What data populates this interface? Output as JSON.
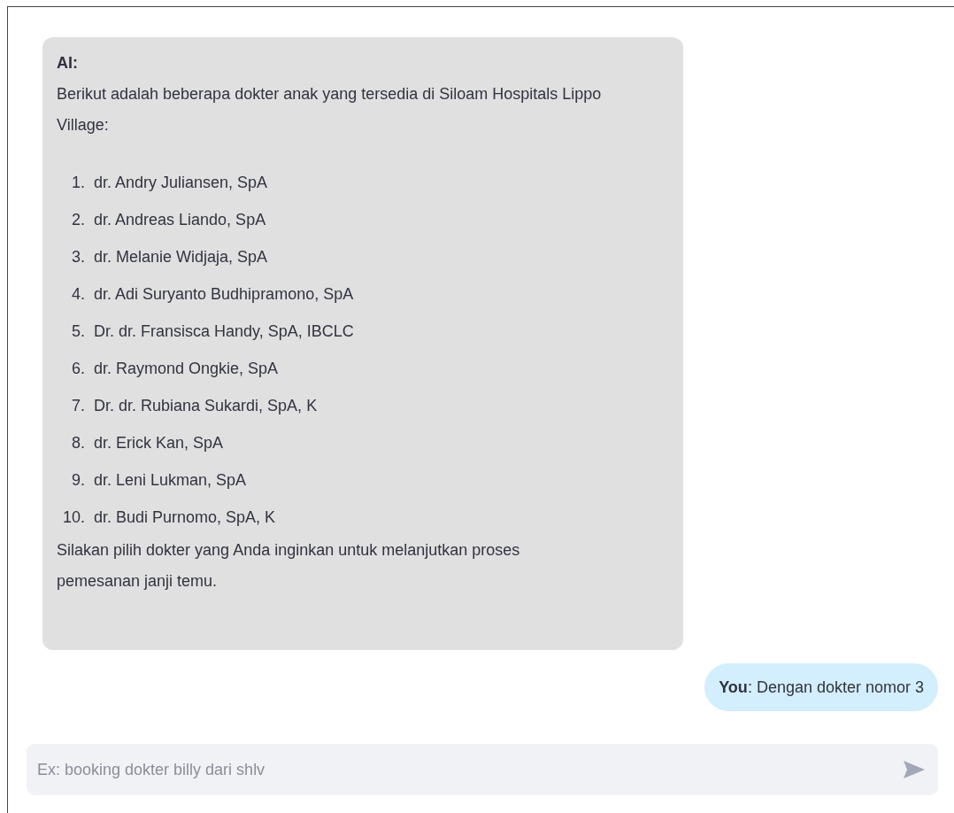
{
  "messages": [
    {
      "kind": "ai",
      "speaker": "AI:",
      "intro": "Berikut adalah beberapa dokter anak yang tersedia di Siloam Hospitals Lippo Village:",
      "items": [
        {
          "number": "1.",
          "text": "dr. Andry Juliansen, SpA"
        },
        {
          "number": "2.",
          "text": "dr. Andreas Liando, SpA"
        },
        {
          "number": "3.",
          "text": "dr. Melanie Widjaja, SpA"
        },
        {
          "number": "4.",
          "text": "dr. Adi Suryanto Budhipramono, SpA"
        },
        {
          "number": "5.",
          "text": "Dr. dr. Fransisca Handy, SpA, IBCLC"
        },
        {
          "number": "6.",
          "text": "dr. Raymond Ongkie, SpA"
        },
        {
          "number": "7.",
          "text": "Dr. dr. Rubiana Sukardi, SpA, K"
        },
        {
          "number": "8.",
          "text": "dr. Erick Kan, SpA"
        },
        {
          "number": "9.",
          "text": "dr. Leni Lukman, SpA"
        },
        {
          "number": "10.",
          "text": "dr. Budi Purnomo, SpA, K"
        }
      ],
      "closing": "Silakan pilih dokter yang Anda inginkan untuk melanjutkan proses pemesanan janji temu."
    },
    {
      "kind": "user",
      "text": "**You**: Dengan dokter nomor 3"
    }
  ],
  "input": {
    "placeholder": "Ex: booking dokter billy dari shlv"
  }
}
